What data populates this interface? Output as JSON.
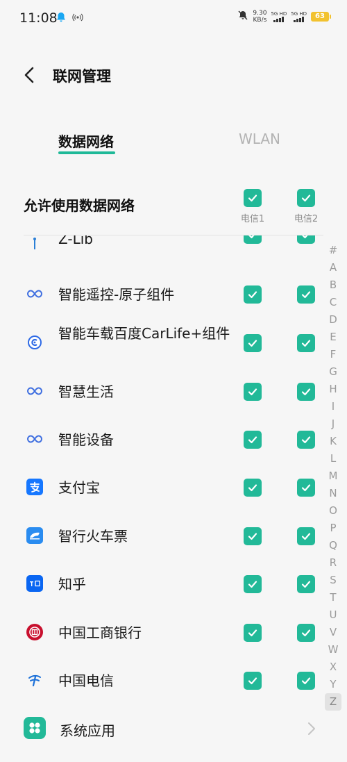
{
  "status": {
    "time": "11:08",
    "net_speed_value": "9.30",
    "net_speed_unit": "KB/s",
    "sim1_type": "5G HD",
    "sim2_type": "5G HD",
    "battery": "63"
  },
  "header": {
    "title": "联网管理"
  },
  "tabs": [
    {
      "label": "数据网络",
      "active": true
    },
    {
      "label": "WLAN",
      "active": false
    }
  ],
  "allow": {
    "label": "允许使用数据网络",
    "sim1_label": "电信1",
    "sim2_label": "电信2"
  },
  "apps": [
    {
      "name": "Z-Lib",
      "icon": "z-lib-icon"
    },
    {
      "name": "智能遥控-原子组件",
      "icon": "infinity-icon"
    },
    {
      "name": "智能车载百度CarLife+组件",
      "icon": "carlife-icon"
    },
    {
      "name": "智慧生活",
      "icon": "infinity-icon"
    },
    {
      "name": "智能设备",
      "icon": "infinity-icon"
    },
    {
      "name": "支付宝",
      "icon": "alipay-icon"
    },
    {
      "name": "智行火车票",
      "icon": "train-icon"
    },
    {
      "name": "知乎",
      "icon": "zhihu-icon"
    },
    {
      "name": "中国工商银行",
      "icon": "icbc-icon"
    },
    {
      "name": "中国电信",
      "icon": "china-telecom-icon"
    }
  ],
  "index_letters": [
    "#",
    "A",
    "B",
    "C",
    "D",
    "E",
    "F",
    "G",
    "H",
    "I",
    "J",
    "K",
    "L",
    "M",
    "N",
    "O",
    "P",
    "Q",
    "R",
    "S",
    "T",
    "U",
    "V",
    "W",
    "X",
    "Y",
    "Z"
  ],
  "index_active": "Z",
  "system_apps": {
    "label": "系统应用"
  },
  "colors": {
    "accent": "#22b998",
    "battery": "#f2c230"
  }
}
